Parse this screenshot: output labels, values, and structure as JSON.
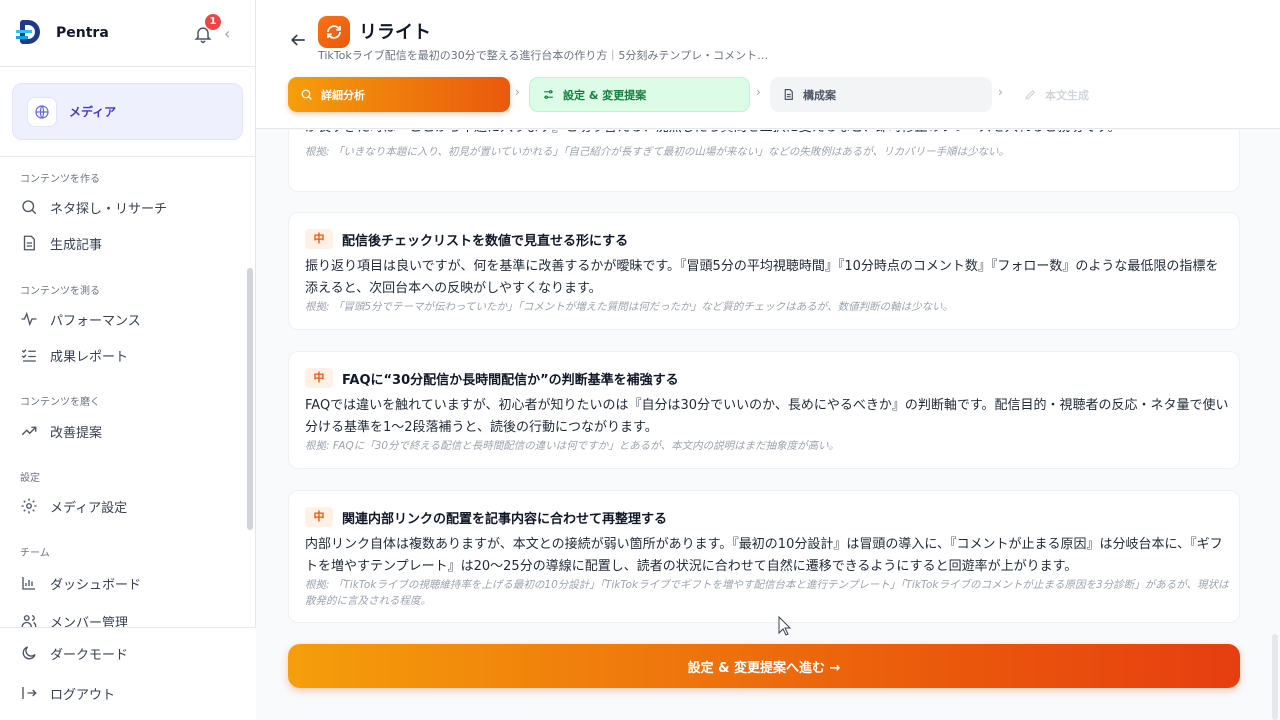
{
  "app": {
    "brand": "Pentra",
    "notifications_count": "1"
  },
  "sidebar": {
    "media_label": "メディア",
    "sections": [
      {
        "label": "コンテンツを作る",
        "items": [
          {
            "label": "ネタ探し・リサーチ",
            "icon": "search-icon"
          },
          {
            "label": "生成記事",
            "icon": "document-icon"
          }
        ]
      },
      {
        "label": "コンテンツを測る",
        "items": [
          {
            "label": "パフォーマンス",
            "icon": "pulse-icon"
          },
          {
            "label": "成果レポート",
            "icon": "checklist-icon"
          }
        ]
      },
      {
        "label": "コンテンツを磨く",
        "items": [
          {
            "label": "改善提案",
            "icon": "trend-icon"
          }
        ]
      },
      {
        "label": "設定",
        "items": [
          {
            "label": "メディア設定",
            "icon": "gear-icon"
          }
        ]
      },
      {
        "label": "チーム",
        "items": [
          {
            "label": "ダッシュボード",
            "icon": "bar-chart-icon"
          },
          {
            "label": "メンバー管理",
            "icon": "users-icon"
          }
        ]
      }
    ],
    "dark_mode": "ダークモード",
    "logout": "ログアウト"
  },
  "header": {
    "title": "リライト",
    "subtitle": "TikTokライブ配信を最初の30分で整える進行台本の作り方｜5分刻みテンプレ・コメント…",
    "steps": [
      {
        "label": "詳細分析",
        "state": "active"
      },
      {
        "label": "設定 & 変更提案",
        "state": "next"
      },
      {
        "label": "構成案",
        "state": "pending"
      },
      {
        "label": "本文生成",
        "state": "disabled"
      }
    ]
  },
  "top_card": {
    "body_line": "が長すぎた時は『ここから本題に入ります』と切り替える、沈黙したら質問を二択に変えるなど、即時修正のフレーズを入れると親切です。",
    "note": "根拠: 「いきなり本題に入り、初見が置いていかれる」「自己紹介が長すぎて最初の山場が来ない」などの失敗例はあるが、リカバリー手順は少ない。"
  },
  "suggestions": [
    {
      "priority": "中",
      "title": "配信後チェックリストを数値で見直せる形にする",
      "body": "振り返り項目は良いですが、何を基準に改善するかが曖昧です。『冒頭5分の平均視聴時間』『10分時点のコメント数』『フォロー数』のような最低限の指標を添えると、次回台本への反映がしやすくなります。",
      "note": "根拠: 「冒頭5分でテーマが伝わっていたか」「コメントが増えた質問は何だったか」など質的チェックはあるが、数値判断の軸は少ない。"
    },
    {
      "priority": "中",
      "title": "FAQに“30分配信か長時間配信か”の判断基準を補強する",
      "body": "FAQでは違いを触れていますが、初心者が知りたいのは『自分は30分でいいのか、長めにやるべきか』の判断軸です。配信目的・視聴者の反応・ネタ量で使い分ける基準を1〜2段落補うと、読後の行動につながります。",
      "note": "根拠: FAQに「30分で終える配信と長時間配信の違いは何ですか」とあるが、本文内の説明はまだ抽象度が高い。"
    },
    {
      "priority": "中",
      "title": "関連内部リンクの配置を記事内容に合わせて再整理する",
      "body": "内部リンク自体は複数ありますが、本文との接続が弱い箇所があります。『最初の10分設計』は冒頭の導入に、『コメントが止まる原因』は分岐台本に、『ギフトを増やすテンプレート』は20〜25分の導線に配置し、読者の状況に合わせて自然に遷移できるようにすると回遊率が上がります。",
      "note": "根拠: 「TikTokライブの視聴維持率を上げる最初の10分設計」「TikTokライブでギフトを増やす配信台本と進行テンプレート」「TikTokライブのコメントが止まる原因を3分診断」があるが、現状は散発的に言及される程度。"
    }
  ],
  "cta_label": "設定 & 変更提案へ進む →",
  "colors": {
    "accent": "#ea580c",
    "accent_light": "#f59e0b",
    "media_bg": "#eef0fe",
    "step_next_bg": "#dcfce7"
  }
}
